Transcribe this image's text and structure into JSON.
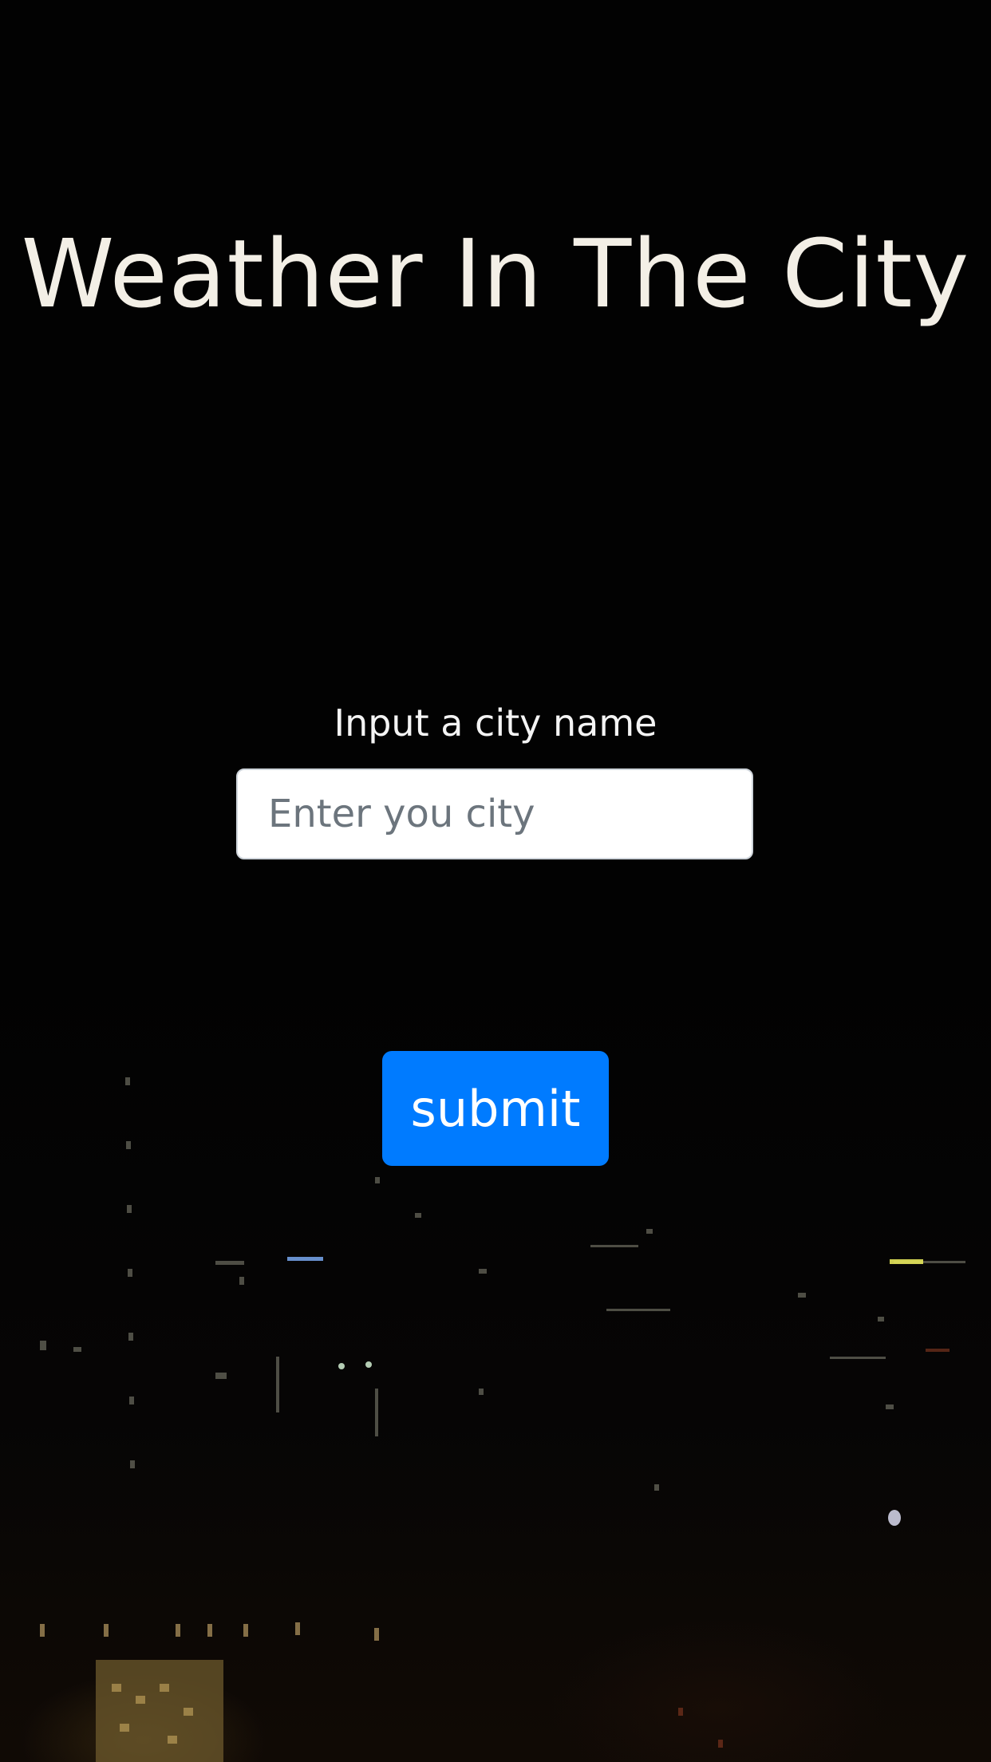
{
  "header": {
    "title": "Weather In The City"
  },
  "form": {
    "label": "Input a city name",
    "input_placeholder": "Enter you city",
    "input_value": "",
    "submit_label": "submit"
  },
  "theme": {
    "background": "#020202",
    "title_color": "#f3efe6",
    "button_color": "#007bff",
    "button_text_color": "#ffffff"
  }
}
